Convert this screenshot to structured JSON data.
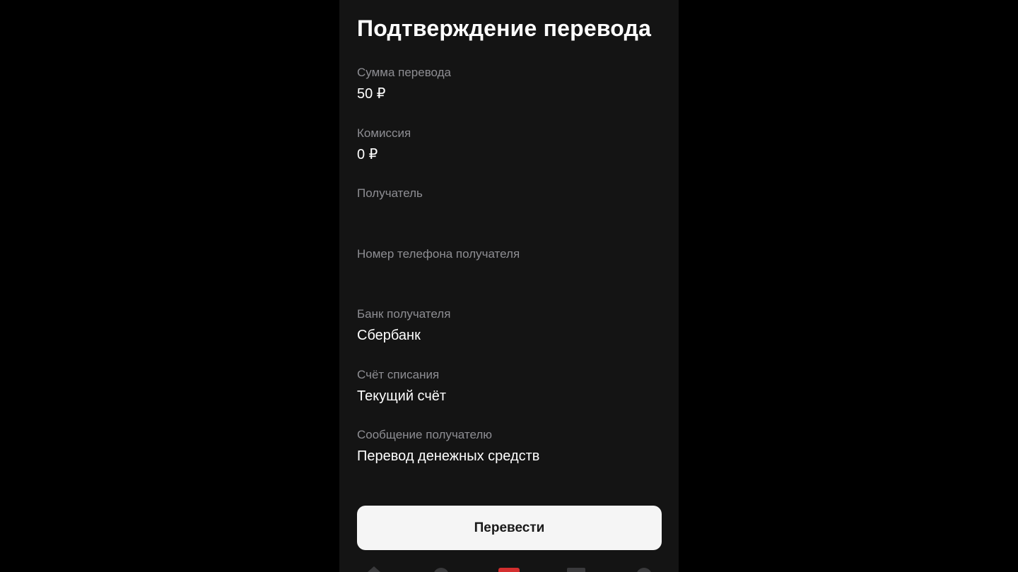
{
  "screen": {
    "title": "Подтверждение перевода"
  },
  "fields": {
    "amount": {
      "label": "Сумма перевода",
      "value": "50 ₽"
    },
    "commission": {
      "label": "Комиссия",
      "value": "0 ₽"
    },
    "recipient": {
      "label": "Получатель",
      "value": ""
    },
    "recipient_phone": {
      "label": "Номер телефона получателя",
      "value": ""
    },
    "recipient_bank": {
      "label": "Банк получателя",
      "value": "Сбербанк"
    },
    "debit_account": {
      "label": "Счёт списания",
      "value": "Текущий счёт"
    },
    "message": {
      "label": "Сообщение получателю",
      "value": "Перевод денежных средств"
    }
  },
  "actions": {
    "transfer_label": "Перевести"
  },
  "tabbar": {
    "icons": [
      "home-icon",
      "profile-icon",
      "payments-icon",
      "services-icon",
      "chat-icon"
    ]
  },
  "colors": {
    "background": "#000000",
    "panel": "#141414",
    "label": "#8e8e93",
    "value": "#ffffff",
    "button_bg": "#f5f5f5",
    "button_text": "#1a1a1a",
    "accent": "#d32f2f"
  }
}
